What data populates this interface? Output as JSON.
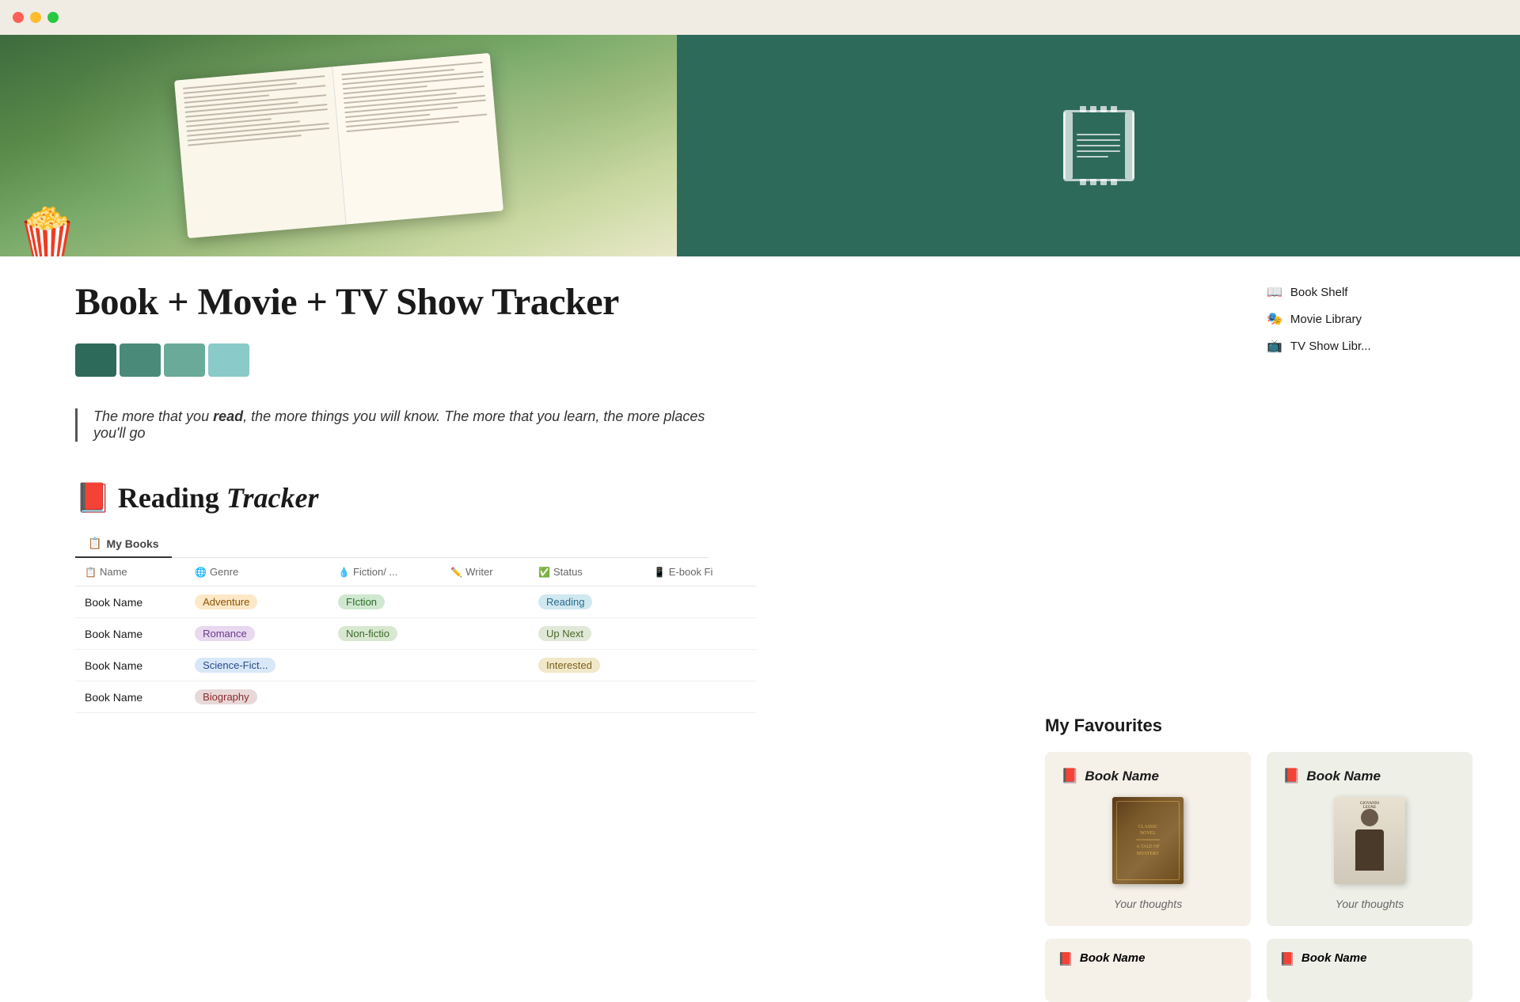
{
  "titlebar": {
    "buttons": [
      "close",
      "minimize",
      "maximize"
    ]
  },
  "hero": {
    "popcorn_emoji": "🍿",
    "film_icon_label": "film-clapper-icon",
    "hero_right_bg": "#2d6a5a"
  },
  "page": {
    "title": "Book  + Movie + TV Show Tracker",
    "quote": "The more that you read, the more things you will know. The more that you learn, the more places you'll go",
    "quote_bold": "read"
  },
  "swatches": [
    {
      "color": "#2d6a5a",
      "label": "dark teal"
    },
    {
      "color": "#4a8a78",
      "label": "medium teal"
    },
    {
      "color": "#6aaa98",
      "label": "light teal"
    },
    {
      "color": "#8acac8",
      "label": "pale teal"
    }
  ],
  "sidebar": {
    "links": [
      {
        "icon": "📖",
        "label": "Book Shelf"
      },
      {
        "icon": "🎭",
        "label": "Movie Library"
      },
      {
        "icon": "📺",
        "label": "TV Show Libr..."
      }
    ]
  },
  "reading_tracker": {
    "title_emoji": "📕",
    "title_text": "Reading",
    "title_italic": "Tracker",
    "tab_label": "My Books",
    "tab_icon": "📋",
    "table": {
      "columns": [
        {
          "icon": "📋",
          "label": "Name"
        },
        {
          "icon": "🌐",
          "label": "Genre"
        },
        {
          "icon": "💧",
          "label": "Fiction/ ..."
        },
        {
          "icon": "✏️",
          "label": "Writer"
        },
        {
          "icon": "✅",
          "label": "Status"
        },
        {
          "icon": "📱",
          "label": "E-book Fi"
        }
      ],
      "rows": [
        {
          "name": "Book Name",
          "genre": "Adventure",
          "genre_class": "adventure",
          "fiction": "FIction",
          "fiction_class": "fiction",
          "writer": "",
          "status": "Reading",
          "status_class": "reading",
          "ebook": ""
        },
        {
          "name": "Book Name",
          "genre": "Romance",
          "genre_class": "romance",
          "fiction": "Non-fictio",
          "fiction_class": "nonfiction",
          "writer": "",
          "status": "Up Next",
          "status_class": "upnext",
          "ebook": ""
        },
        {
          "name": "Book Name",
          "genre": "Science-Fict...",
          "genre_class": "scifi",
          "fiction": "",
          "fiction_class": "",
          "writer": "",
          "status": "Interested",
          "status_class": "interested",
          "ebook": ""
        },
        {
          "name": "Book Name",
          "genre": "Biography",
          "genre_class": "biography",
          "fiction": "",
          "fiction_class": "",
          "writer": "",
          "status": "",
          "status_class": "",
          "ebook": ""
        }
      ]
    }
  },
  "favourites": {
    "section_title": "My Favourites",
    "cards": [
      {
        "emoji": "📕",
        "book_name": "Book Name",
        "cover_type": "old_book",
        "thoughts": "Your thoughts"
      },
      {
        "emoji": "📕",
        "book_name": "Book Name",
        "cover_type": "person",
        "thoughts": "Your thoughts"
      },
      {
        "emoji": "📕",
        "book_name": "Book Name",
        "cover_type": "bottom",
        "thoughts": ""
      },
      {
        "emoji": "📕",
        "book_name": "Book Name",
        "cover_type": "bottom",
        "thoughts": ""
      }
    ],
    "bottom_card1": {
      "emoji": "📕",
      "label": "Book Name"
    },
    "bottom_card2": {
      "emoji": "📕",
      "label": "Book Name"
    }
  }
}
